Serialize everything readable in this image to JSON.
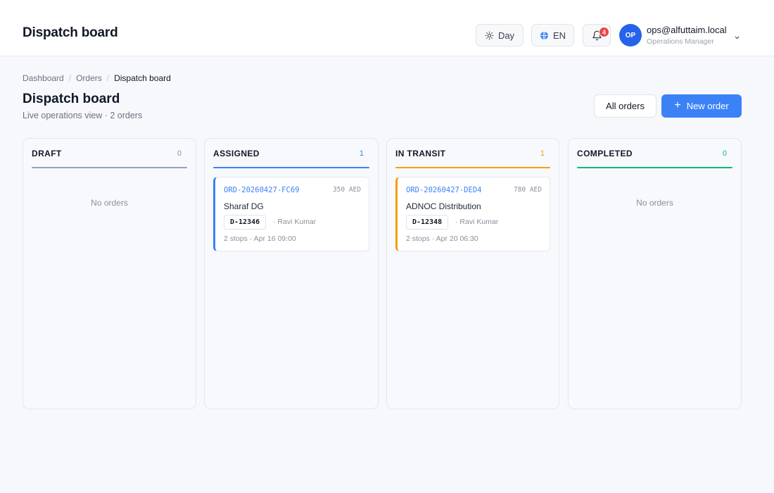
{
  "header": {
    "title": "Dispatch board",
    "theme_label": "Day",
    "lang_label": "EN",
    "notif_count": "4",
    "avatar_initials": "OP",
    "user_email": "ops@alfuttaim.local",
    "user_role": "Operations Manager"
  },
  "breadcrumb": [
    "Dashboard",
    "Orders",
    "Dispatch board"
  ],
  "page": {
    "title": "Dispatch board",
    "subtitle": "Live operations view · 2 orders",
    "all_orders_label": "All orders",
    "new_order_label": "New order"
  },
  "columns": [
    {
      "title": "DRAFT",
      "count": "0",
      "color": "#94a3b8",
      "count_color": "#8a919c",
      "empty_text": "No orders"
    },
    {
      "title": "ASSIGNED",
      "count": "1",
      "color": "#3b82f6",
      "count_color": "#3b82f6",
      "card": {
        "id": "ORD-20260427-FC69",
        "amount": "350 AED",
        "customer": "Sharaf DG",
        "vehicle": "D-12346",
        "driver": "· Ravi Kumar",
        "meta": "2 stops · Apr 16 09:00"
      }
    },
    {
      "title": "IN TRANSIT",
      "count": "1",
      "color": "#f59e0b",
      "count_color": "#f59e0b",
      "card": {
        "id": "ORD-20260427-DED4",
        "amount": "780 AED",
        "customer": "ADNOC Distribution",
        "vehicle": "D-12348",
        "driver": "· Ravi Kumar",
        "meta": "2 stops · Apr 20 06:30"
      }
    },
    {
      "title": "COMPLETED",
      "count": "0",
      "color": "#10b981",
      "count_color": "#10b981",
      "empty_text": "No orders"
    }
  ],
  "icons": {
    "theme": "sun-icon",
    "lang": "globe-icon",
    "notifications": "bell-icon",
    "user_menu": "chevron-down-icon",
    "new_order": "plus-icon"
  }
}
